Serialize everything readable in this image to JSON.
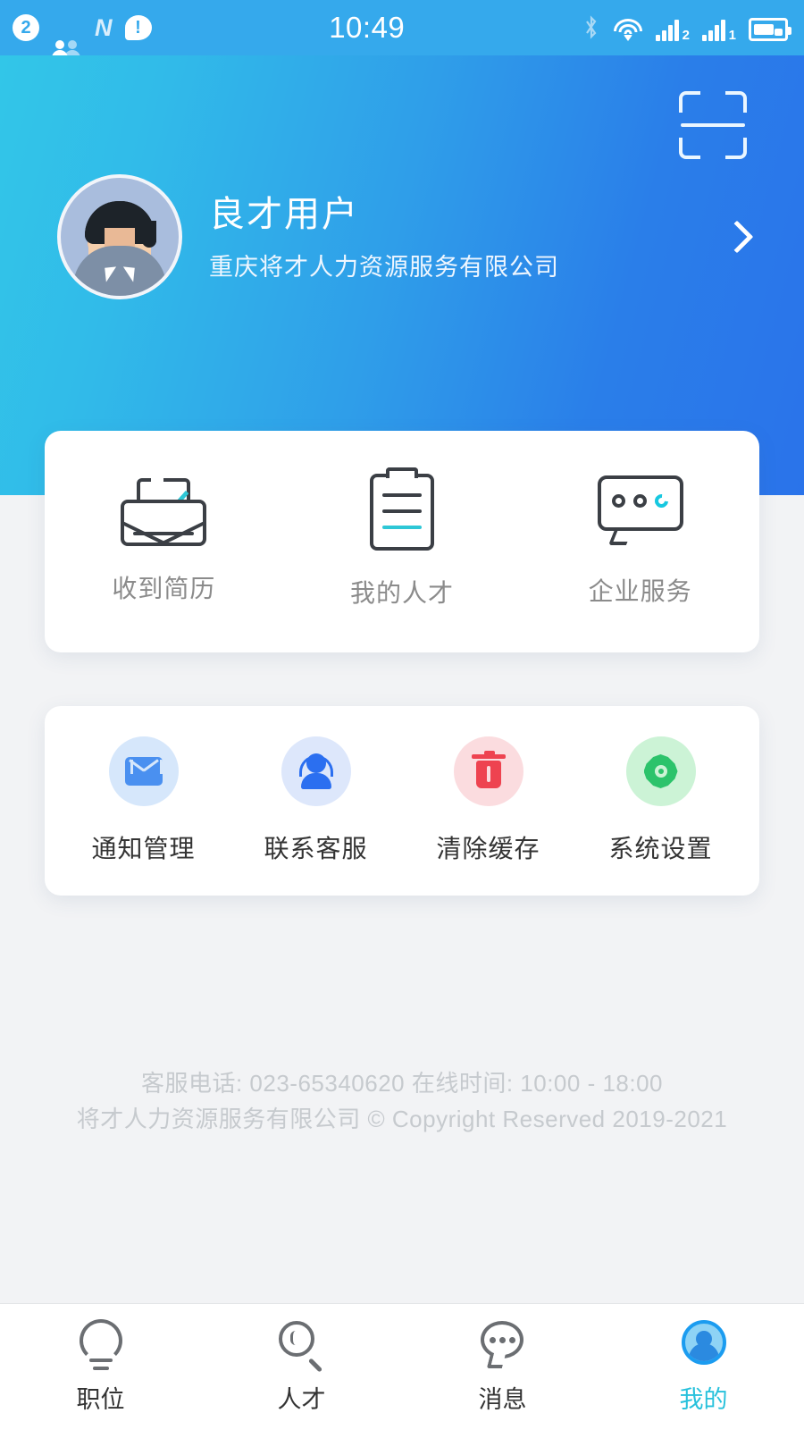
{
  "status_bar": {
    "time": "10:49",
    "left_icons": [
      {
        "name": "notification-count-icon",
        "label": "2"
      },
      {
        "name": "contacts-icon",
        "label": ""
      },
      {
        "name": "netease-n-icon",
        "label": "N"
      },
      {
        "name": "alert-exclamation-icon",
        "label": "!"
      }
    ],
    "right_icons": [
      {
        "name": "bluetooth-icon"
      },
      {
        "name": "wifi-icon"
      },
      {
        "name": "signal-sim2-icon",
        "label": "2"
      },
      {
        "name": "signal-sim1-icon",
        "label": "1"
      },
      {
        "name": "battery-charging-icon"
      }
    ]
  },
  "header": {
    "scan_icon": "scan-qr-icon",
    "chevron_icon": "chevron-right-icon",
    "avatar_icon": "user-avatar",
    "user_name": "良才用户",
    "company_name": "重庆将才人力资源服务有限公司",
    "gradient_from": "#32c6e8",
    "gradient_to": "#2a73ea"
  },
  "quick_actions": [
    {
      "icon": "envelope-check-icon",
      "label": "收到简历"
    },
    {
      "icon": "clipboard-lines-icon",
      "label": "我的人才"
    },
    {
      "icon": "chat-bubble-dots-icon",
      "label": "企业服务"
    }
  ],
  "tools": [
    {
      "icon": "mail-icon",
      "label": "通知管理",
      "tile_color": "#d6e7fb",
      "glyph_color": "#4a90f0"
    },
    {
      "icon": "headset-support-icon",
      "label": "联系客服",
      "tile_color": "#dde7fb",
      "glyph_color": "#2b6ff0"
    },
    {
      "icon": "trash-icon",
      "label": "清除缓存",
      "tile_color": "#fbdcdf",
      "glyph_color": "#ee4350"
    },
    {
      "icon": "gear-icon",
      "label": "系统设置",
      "tile_color": "#ccf3d6",
      "glyph_color": "#2cc36b"
    }
  ],
  "footer": {
    "line1": "客服电话: 023-65340620   在线时间: 10:00 - 18:00",
    "line2": "将才人力资源服务有限公司  © Copyright Reserved 2019-2021"
  },
  "tab_bar": {
    "active_color": "#27c1dc",
    "items": [
      {
        "icon": "lightbulb-icon",
        "label": "职位",
        "active": false
      },
      {
        "icon": "magnifier-icon",
        "label": "人才",
        "active": false
      },
      {
        "icon": "message-bubble-icon",
        "label": "消息",
        "active": false
      },
      {
        "icon": "profile-person-icon",
        "label": "我的",
        "active": true
      }
    ]
  }
}
